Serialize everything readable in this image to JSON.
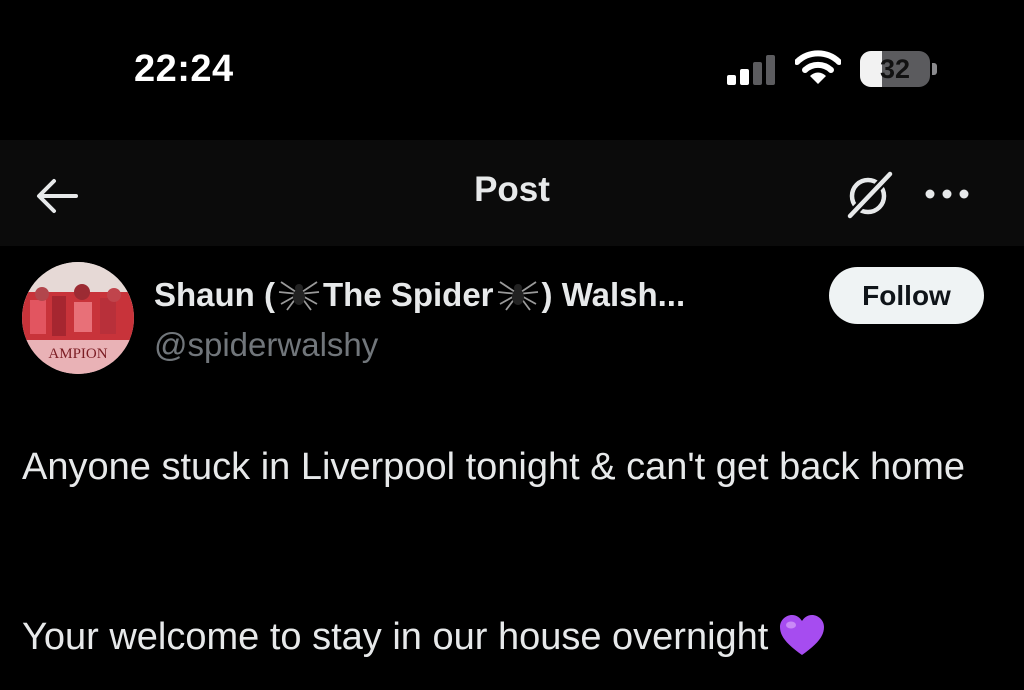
{
  "status_bar": {
    "time": "22:24",
    "battery_text": "32",
    "battery_level": 0.32,
    "signal_bars_active": 2,
    "signal_bars_total": 4
  },
  "header": {
    "title": "Post",
    "back_icon": "arrow-left-icon",
    "grok_icon": "grok-icon",
    "more_icon": "more-horizontal-icon"
  },
  "post": {
    "author": {
      "name_part1": "Shaun (",
      "name_part2": "The Spider",
      "name_part3": ") Walsh...",
      "handle": "@spiderwalshy",
      "avatar_text": "AMPION"
    },
    "follow_label": "Follow",
    "text_line1": "Anyone stuck in Liverpool tonight & can't get back home",
    "text_line2": "Your welcome to stay in our house overnight"
  },
  "colors": {
    "background": "#000000",
    "header_background": "#0b0b0b",
    "primary_text": "#e7e9ea",
    "secondary_text": "#71767b",
    "follow_bg": "#eff3f4",
    "heart": "#a64cf0"
  }
}
